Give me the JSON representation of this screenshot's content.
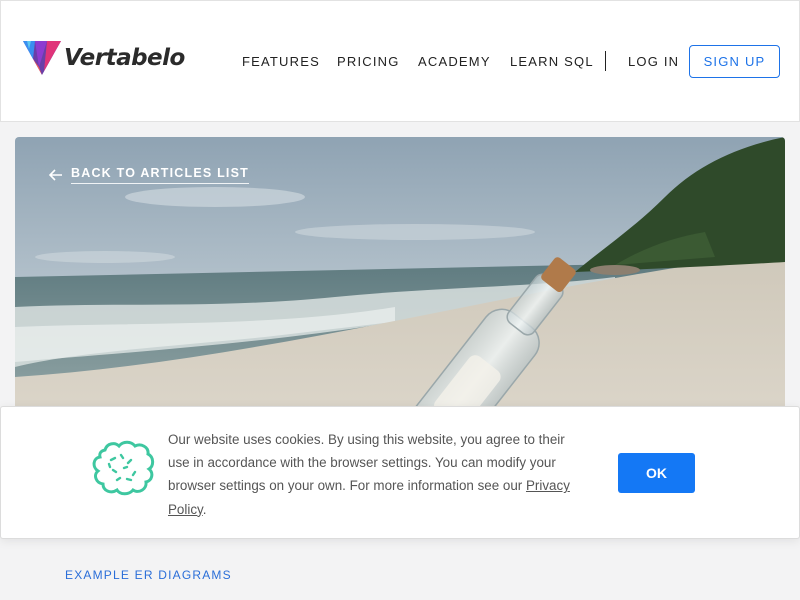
{
  "header": {
    "logo_text": "Vertabelo",
    "nav": [
      "FEATURES",
      "PRICING",
      "ACADEMY",
      "LEARN SQL"
    ],
    "login": "LOG IN",
    "signup": "SIGN UP"
  },
  "hero": {
    "back_label": "BACK TO ARTICLES LIST"
  },
  "cookie_banner": {
    "text": "Our website uses cookies. By using this website, you agree to their use in accordance with the browser settings. You can modify your browser settings on your own. For more information see our ",
    "policy_link": "Privacy Policy",
    "text_end": ".",
    "ok_button": "OK"
  },
  "content": {
    "category_link": "EXAMPLE ER DIAGRAMS"
  },
  "colors": {
    "accent": "#1e73e8",
    "ok_button": "#1478f5",
    "cookie_icon": "#3ec7a0"
  }
}
